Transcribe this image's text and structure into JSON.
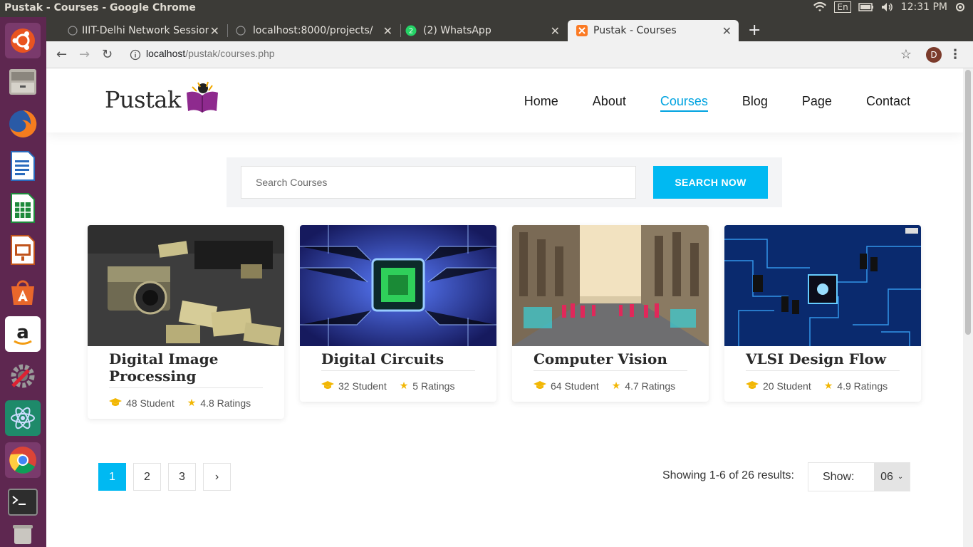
{
  "window": {
    "title": "Pustak - Courses - Google Chrome"
  },
  "system_tray": {
    "language": "En",
    "time": "12:31 PM"
  },
  "browser": {
    "tabs": [
      {
        "label": "IIIT-Delhi Network Session"
      },
      {
        "label": "localhost:8000/projects/"
      },
      {
        "label": "(2) WhatsApp"
      },
      {
        "label": "Pustak - Courses"
      }
    ],
    "url_host": "localhost",
    "url_path": "/pustak/courses.php",
    "profile_initial": "D"
  },
  "site": {
    "logo_text": "Pustak",
    "nav": [
      {
        "label": "Home"
      },
      {
        "label": "About"
      },
      {
        "label": "Courses"
      },
      {
        "label": "Blog"
      },
      {
        "label": "Page"
      },
      {
        "label": "Contact"
      }
    ],
    "search": {
      "placeholder": "Search Courses",
      "button": "SEARCH NOW"
    },
    "courses": [
      {
        "title": "Digital Image Processing",
        "students": "48 Student",
        "ratings": "4.8 Ratings"
      },
      {
        "title": "Digital Circuits",
        "students": "32 Student",
        "ratings": "5 Ratings"
      },
      {
        "title": "Computer Vision",
        "students": "64 Student",
        "ratings": "4.7 Ratings"
      },
      {
        "title": "VLSI Design Flow",
        "students": "20 Student",
        "ratings": "4.9 Ratings"
      }
    ],
    "pagination": {
      "pages": [
        "1",
        "2",
        "3"
      ],
      "next": "›"
    },
    "results_text": "Showing 1-6 of 26 results:",
    "show": {
      "label": "Show:",
      "value": "06"
    }
  },
  "colors": {
    "accent": "#00b9f2",
    "launcher": "#5e2750",
    "panel": "#3c3b37"
  }
}
